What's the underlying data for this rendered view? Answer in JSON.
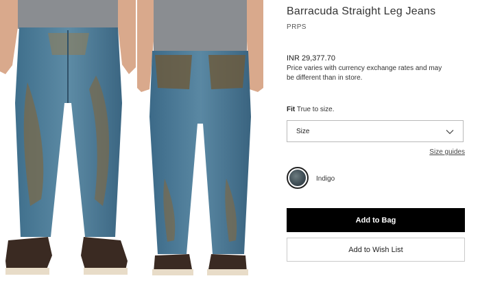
{
  "product": {
    "title": "Barracuda Straight Leg Jeans",
    "brand": "PRPS",
    "price": "INR 29,377.70",
    "price_note": "Price varies with currency exchange rates and may be different than in store.",
    "fit_label": "Fit",
    "fit_value": "True to size."
  },
  "size_select": {
    "label": "Size",
    "icon": "chevron-down-icon"
  },
  "size_guides_link": "Size guides",
  "color": {
    "name": "Indigo",
    "swatch_color": "#4a5a60"
  },
  "buttons": {
    "add_to_bag": "Add to Bag",
    "add_to_wishlist": "Add to Wish List"
  },
  "colors": {
    "primary_button_bg": "#000000",
    "primary_button_text": "#ffffff",
    "border": "#b9b9b9"
  },
  "images": [
    {
      "name": "front-view",
      "description_icon": "jeans-front-photo"
    },
    {
      "name": "back-view",
      "description_icon": "jeans-back-photo"
    }
  ]
}
